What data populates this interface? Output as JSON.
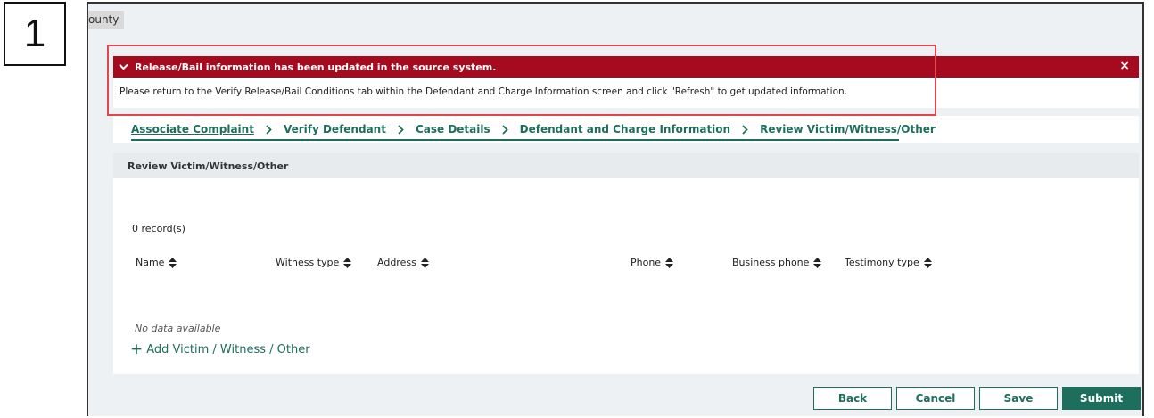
{
  "step_number": "1",
  "header": {
    "county_label": "ounty"
  },
  "alert": {
    "title": "Release/Bail information has been updated in the source system.",
    "close": "×",
    "message": "Please return to the Verify Release/Bail Conditions tab within the Defendant and Charge Information screen and click \"Refresh\" to get updated information."
  },
  "breadcrumb": {
    "items": [
      {
        "label": "Associate Complaint"
      },
      {
        "label": "Verify Defendant"
      },
      {
        "label": "Case Details"
      },
      {
        "label": "Defendant and Charge Information"
      },
      {
        "label": "Review Victim/Witness/Other"
      }
    ]
  },
  "section": {
    "title": "Review Victim/Witness/Other",
    "record_count": "0 record(s)",
    "columns": [
      {
        "label": "Name"
      },
      {
        "label": "Witness type"
      },
      {
        "label": "Address"
      },
      {
        "label": "Phone"
      },
      {
        "label": "Business phone"
      },
      {
        "label": "Testimony type"
      }
    ],
    "empty_text": "No data available",
    "add_label": "Add Victim / Witness / Other"
  },
  "actions": {
    "back": "Back",
    "cancel": "Cancel",
    "save": "Save",
    "submit": "Submit"
  },
  "colors": {
    "alert_red": "#a60a1f",
    "primary_green": "#1d6e5c",
    "highlight_border": "#e0474c"
  }
}
